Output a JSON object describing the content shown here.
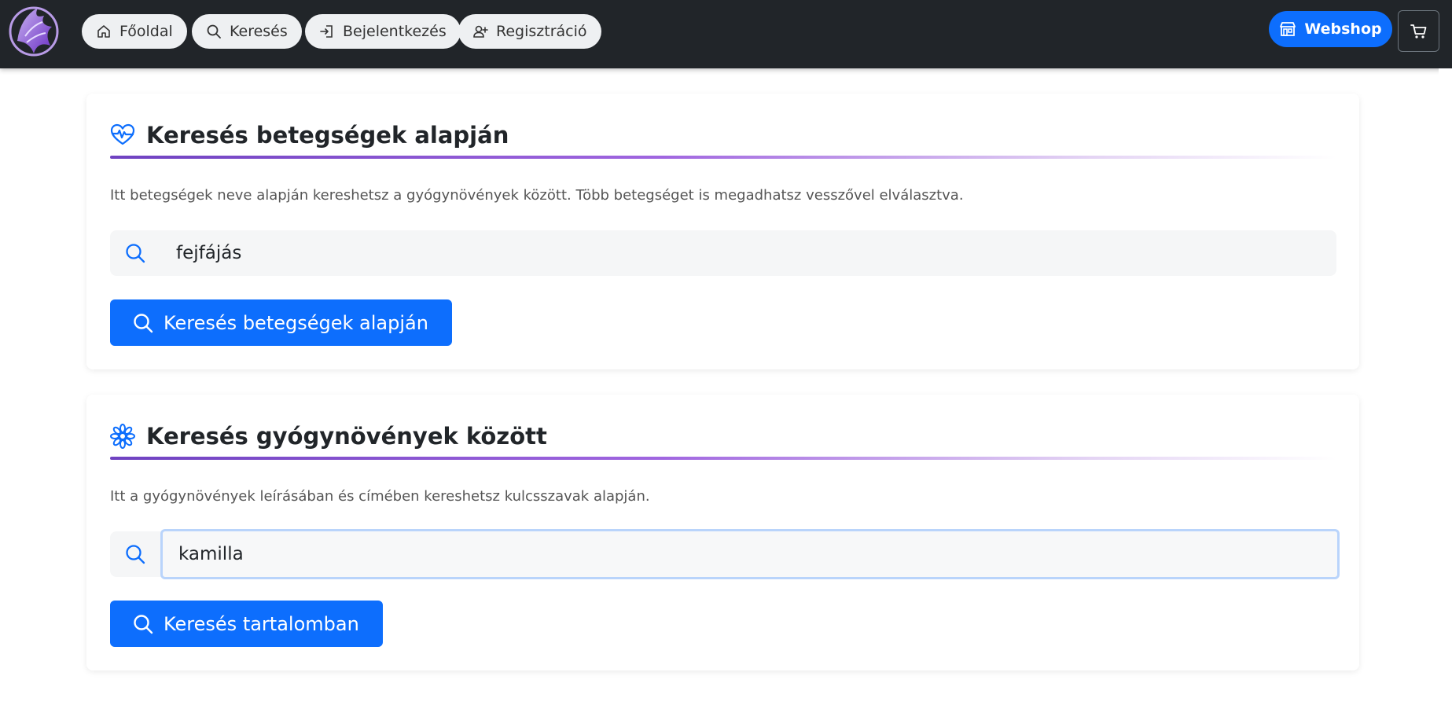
{
  "nav": {
    "items": [
      {
        "label": "Főoldal",
        "icon": "home-icon"
      },
      {
        "label": "Keresés",
        "icon": "search-icon"
      },
      {
        "label": "Bejelentkezés",
        "icon": "login-icon"
      },
      {
        "label": "Regisztráció",
        "icon": "person-add-icon"
      }
    ],
    "webshop_label": "Webshop",
    "accent": "#0d6efd",
    "bg": "#212529"
  },
  "disease_card": {
    "title": "Keresés betegségek alapján",
    "description": "Itt betegségek neve alapján kereshetsz a gyógynövények között. Több betegséget is megadhatsz vesszővel elválasztva.",
    "input_value": "fejfájás",
    "button_label": "Keresés betegségek alapján"
  },
  "herb_card": {
    "title": "Keresés gyógynövények között",
    "description": "Itt a gyógynövények leírásában és címében kereshetsz kulcsszavak alapján.",
    "input_value": "kamilla",
    "button_label": "Keresés tartalomban"
  }
}
